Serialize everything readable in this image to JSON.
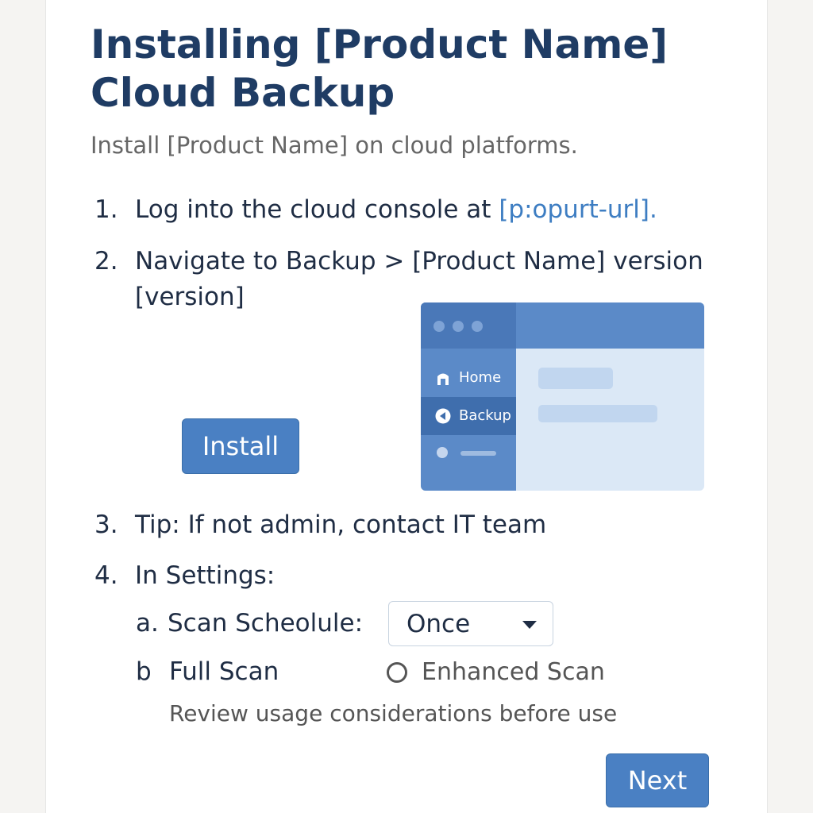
{
  "header": {
    "title_line1": "Installing [Product Name]",
    "title_line2": "Cloud Backup",
    "subtitle": "Install [Product Name] on cloud platforms."
  },
  "steps": [
    {
      "num": "1.",
      "text": "Log into the cloud console at ",
      "link": "[p:opurt-url]."
    },
    {
      "num": "2.",
      "text_line1": "Navigate to Backup > [Product Name] version",
      "text_line2": "[version]"
    },
    {
      "num": "3.",
      "text": "Tip: If not admin, contact IT team"
    },
    {
      "num": "4.",
      "text": "In Settings:"
    }
  ],
  "install_button": {
    "label": "Install"
  },
  "illustration": {
    "sidebar_items": [
      {
        "label": "Home",
        "icon": "home-icon"
      },
      {
        "label": "Backup",
        "icon": "play-icon",
        "active": true
      }
    ]
  },
  "settings": {
    "scan_schedule": {
      "marker": "a.",
      "label": "Scan Scheolule:",
      "selected": "Once"
    },
    "scan_type": {
      "marker": "b",
      "label": "Full Scan",
      "radio_label": "Enhanced Scan"
    },
    "note": "Review usage considerations before use"
  },
  "next_button": {
    "label": "Next"
  },
  "colors": {
    "title": "#1f3c64",
    "link": "#3d7dc2",
    "button": "#4a80c3"
  }
}
